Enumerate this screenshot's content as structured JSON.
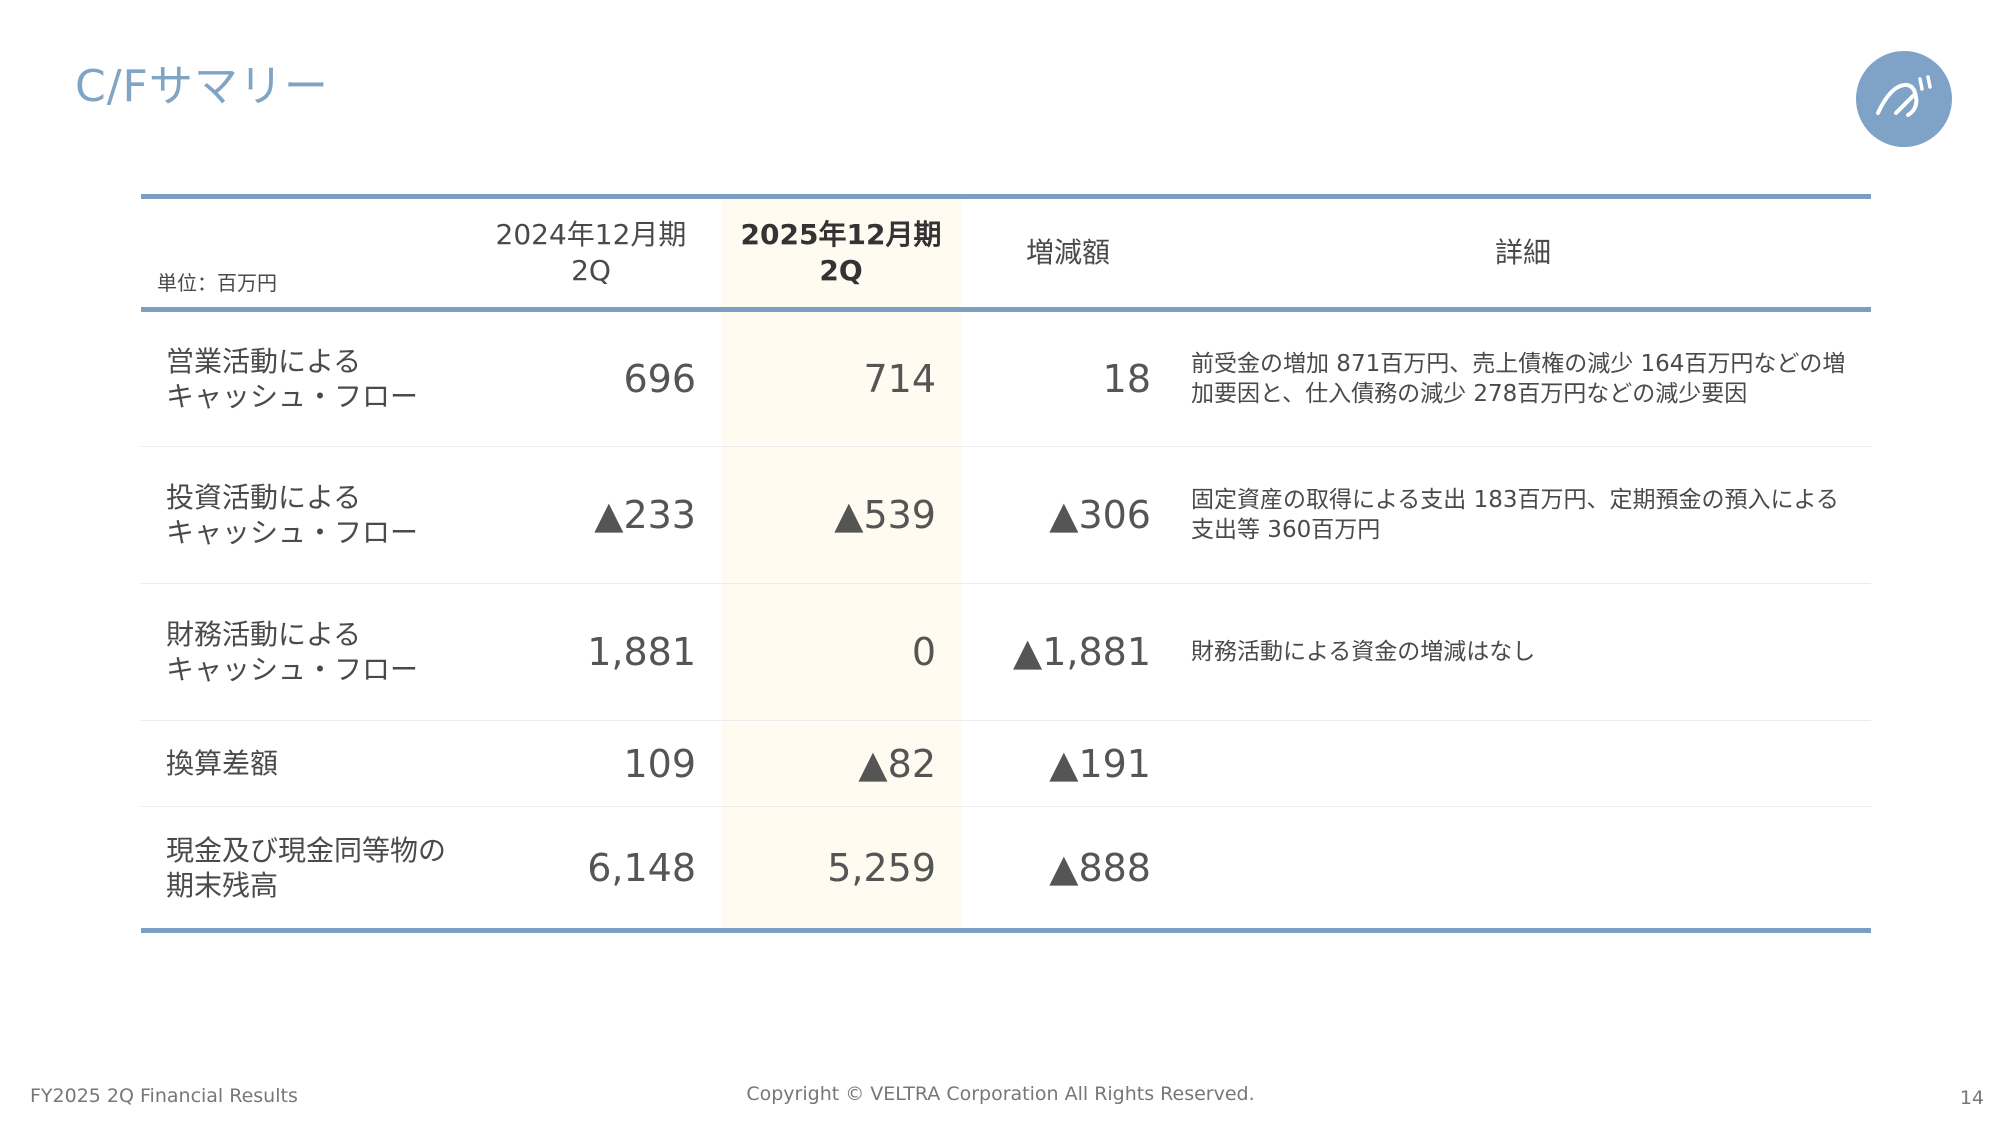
{
  "page": {
    "title": "C/Fサマリー",
    "logo_text": "ベ",
    "footer_left": "FY2025 2Q Financial Results",
    "footer_center": "Copyright © VELTRA Corporation All Rights Reserved.",
    "page_number": "14",
    "highlight_color": "#fffbf1",
    "accent_color": "#7b9fc1"
  },
  "table": {
    "unit": "単位：百万円",
    "headers": {
      "prev_line1": "2024年12月期",
      "prev_line2": "2Q",
      "curr_line1": "2025年12月期",
      "curr_line2": "2Q",
      "diff": "増減額",
      "detail": "詳細"
    },
    "rows": [
      {
        "label_line1": "営業活動による",
        "label_line2": "キャッシュ・フロー",
        "prev": "696",
        "curr": "714",
        "diff": "18",
        "detail": "前受金の増加 871百万円、売上債権の減少 164百万円などの増加要因と、仕入債務の減少 278百万円などの減少要因"
      },
      {
        "label_line1": "投資活動による",
        "label_line2": "キャッシュ・フロー",
        "prev": "▲233",
        "curr": "▲539",
        "diff": "▲306",
        "detail": "固定資産の取得による支出 183百万円、定期預金の預入による支出等 360百万円"
      },
      {
        "label_line1": "財務活動による",
        "label_line2": "キャッシュ・フロー",
        "prev": "1,881",
        "curr": "0",
        "diff": "▲1,881",
        "detail": "財務活動による資金の増減はなし"
      },
      {
        "label_line1": "換算差額",
        "label_line2": "",
        "prev": "109",
        "curr": "▲82",
        "diff": "▲191",
        "detail": ""
      },
      {
        "label_line1": "現金及び現金同等物の",
        "label_line2": "期末残高",
        "prev": "6,148",
        "curr": "5,259",
        "diff": "▲888",
        "detail": ""
      }
    ]
  }
}
